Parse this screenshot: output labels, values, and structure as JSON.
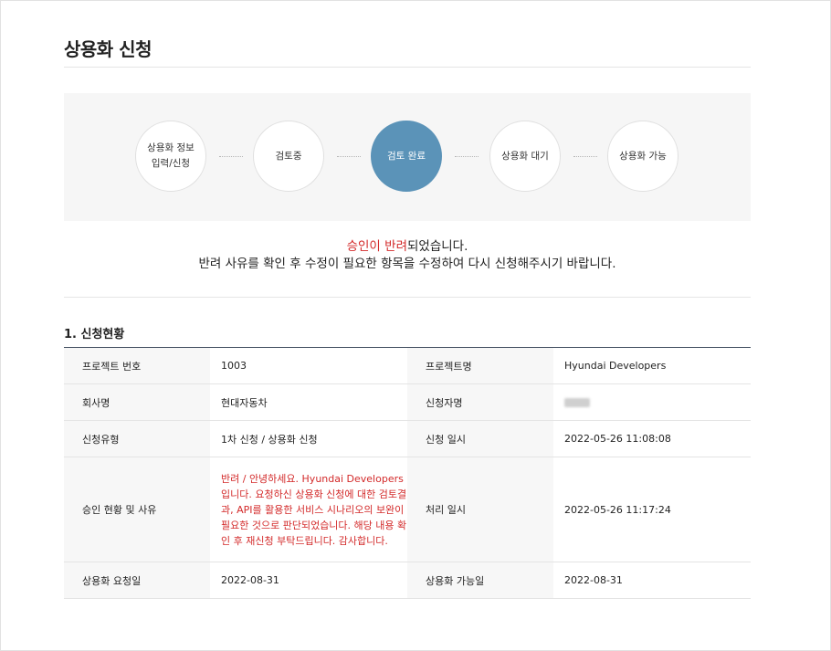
{
  "page": {
    "title": "상용화 신청"
  },
  "steps": [
    {
      "label": "상용화 정보\n입력/신청",
      "active": false
    },
    {
      "label": "검토중",
      "active": false
    },
    {
      "label": "검토 완료",
      "active": true
    },
    {
      "label": "상용화 대기",
      "active": false
    },
    {
      "label": "상용화 가능",
      "active": false
    }
  ],
  "notice": {
    "highlight": "승인이 반려",
    "suffix": "되었습니다.",
    "line2": "반려 사유를 확인 후 수정이 필요한 항목을 수정하여 다시 신청해주시기 바랍니다."
  },
  "section": {
    "title": "1. 신청현황"
  },
  "table": {
    "project_no_label": "프로젝트 번호",
    "project_no_value": "1003",
    "project_name_label": "프로젝트명",
    "project_name_value": "Hyundai Developers",
    "company_label": "회사명",
    "company_value": "현대자동차",
    "applicant_label": "신청자명",
    "type_label": "신청유형",
    "type_value": "1차 신청 / 상용화 신청",
    "apply_date_label": "신청 일시",
    "apply_date_value": "2022-05-26 11:08:08",
    "status_label": "승인 현황 및 사유",
    "status_reason": "반려 / 안녕하세요. Hyundai Developers 입니다. 요청하신 상용화 신청에 대한 검토결과, API를 활용한 서비스 시나리오의 보완이 필요한 것으로 판단되었습니다. 해당 내용 확인 후 재신청 부탁드립니다. 감사합니다.",
    "process_date_label": "처리 일시",
    "process_date_value": "2022-05-26 11:17:24",
    "request_date_label": "상용화 요청일",
    "request_date_value": "2022-08-31",
    "available_date_label": "상용화 가능일",
    "available_date_value": "2022-08-31"
  },
  "colors": {
    "active_step": "#5b93b8",
    "reject_red": "#d32a2a",
    "table_top_border": "#3e4b5c"
  }
}
